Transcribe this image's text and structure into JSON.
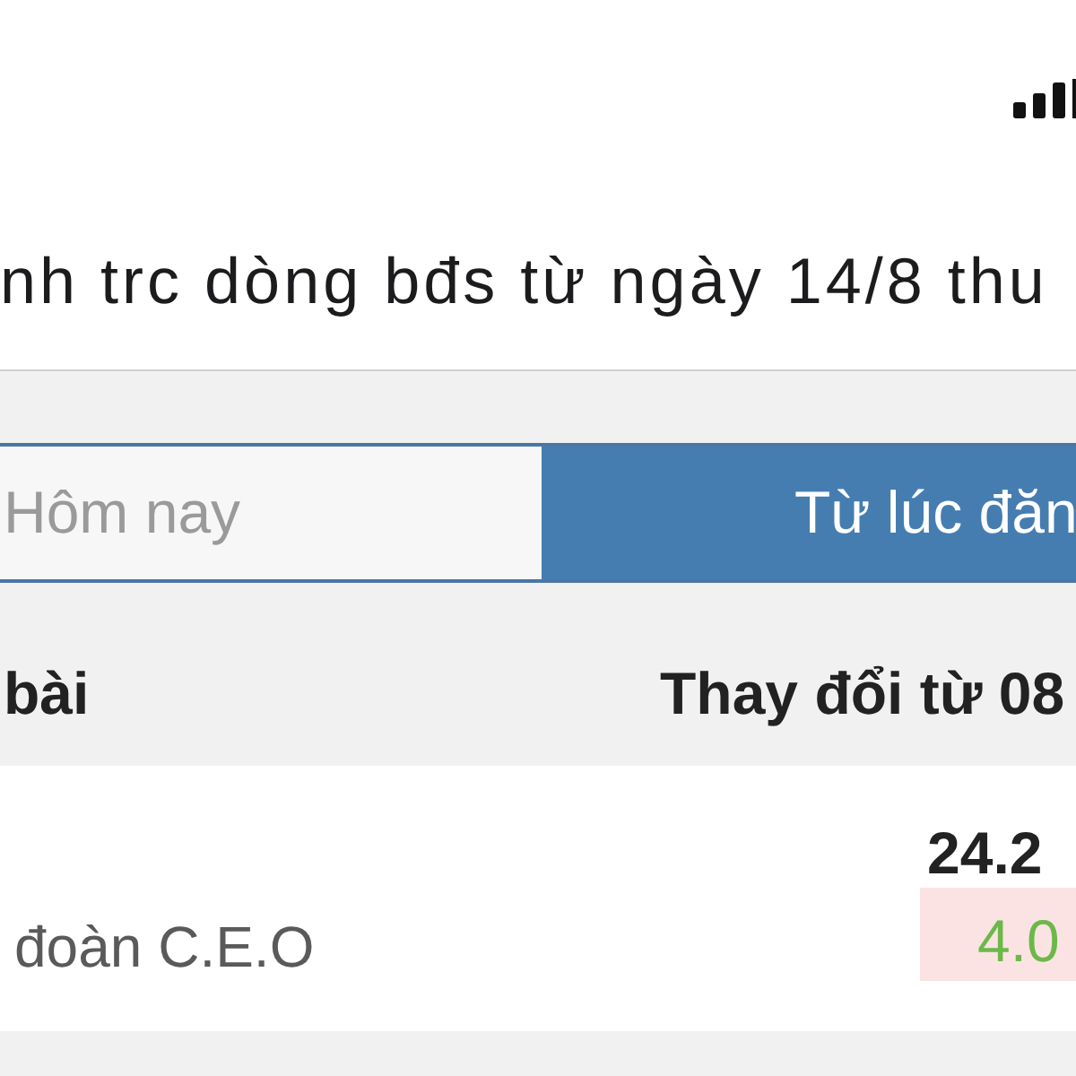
{
  "title": "nh trc dòng bđs từ ngày 14/8 thu",
  "segments": [
    {
      "label": "Hôm nay",
      "selected": false
    },
    {
      "label": "Từ lúc đăn",
      "selected": true
    }
  ],
  "table": {
    "columns": [
      "bài",
      "Thay đổi từ 08"
    ],
    "rows": [
      {
        "name": "đoàn C.E.O",
        "value": "24.2",
        "change": "4.0"
      }
    ]
  }
}
